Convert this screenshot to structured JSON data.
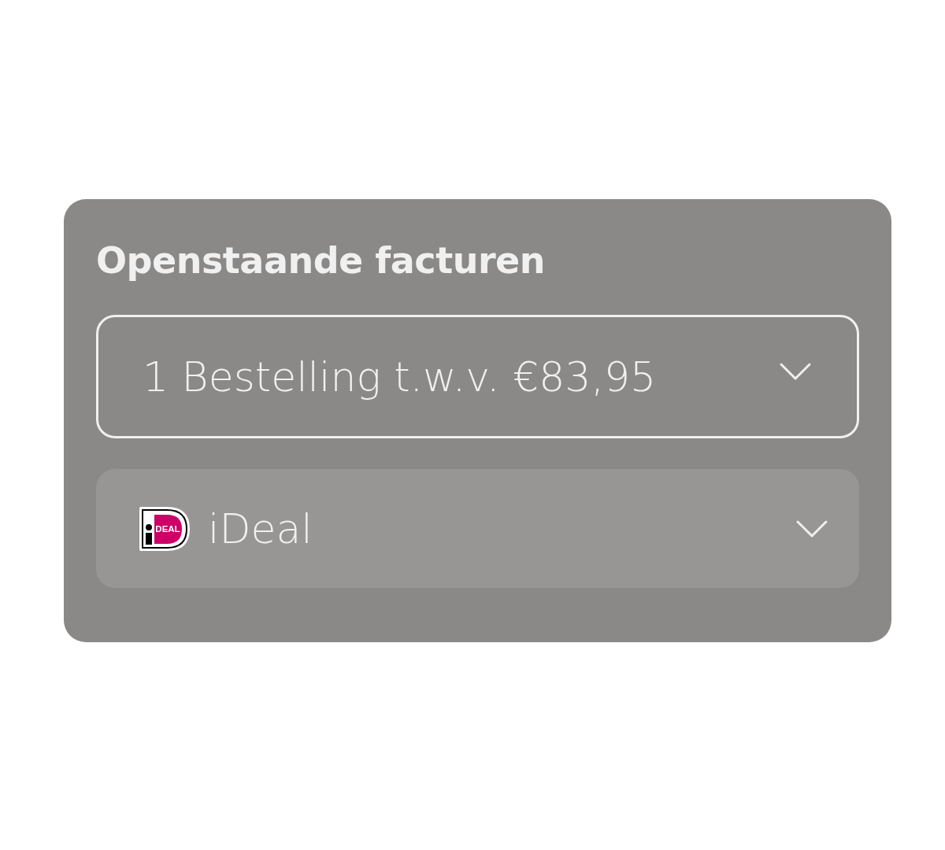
{
  "card": {
    "title": "Openstaande facturen"
  },
  "invoices_select": {
    "value": "1 Bestelling t.w.v. €83,95"
  },
  "payment_select": {
    "logo_text": "DEAL",
    "value": "iDeal"
  }
}
